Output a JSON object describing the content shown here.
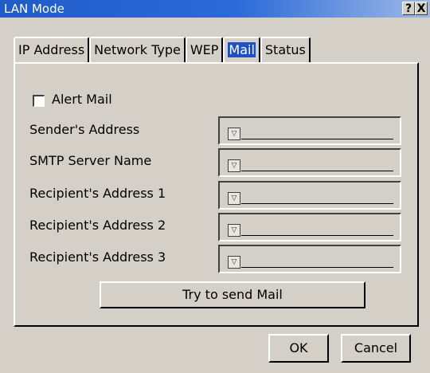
{
  "window": {
    "title": "LAN Mode",
    "help_label": "?",
    "close_label": "X"
  },
  "tabs": [
    "IP Address",
    "Network Type",
    "WEP",
    "Mail",
    "Status"
  ],
  "active_tab": "Mail",
  "mail": {
    "alert_mail_label": "Alert Mail",
    "alert_mail_checked": false,
    "fields": [
      {
        "label": "Sender's Address",
        "value": ""
      },
      {
        "label": "SMTP Server Name",
        "value": ""
      },
      {
        "label": "Recipient's Address 1",
        "value": ""
      },
      {
        "label": "Recipient's Address 2",
        "value": ""
      },
      {
        "label": "Recipient's Address 3",
        "value": ""
      }
    ],
    "send_button": "Try to send Mail"
  },
  "footer": {
    "ok": "OK",
    "cancel": "Cancel"
  }
}
